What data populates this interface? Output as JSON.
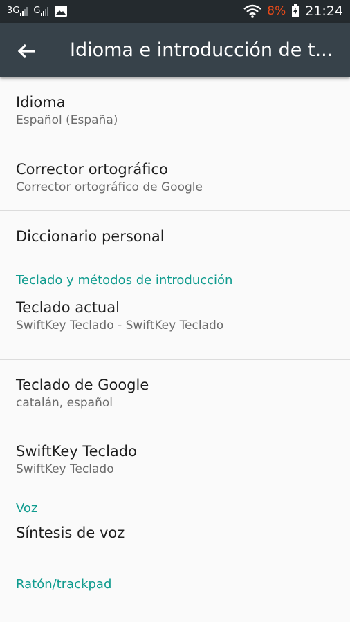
{
  "status_bar": {
    "network1": "3G",
    "network2": "G",
    "battery_percent": "8%",
    "time": "21:24",
    "icons": [
      "signal-icon",
      "image-icon",
      "wifi-icon",
      "battery-charging-icon"
    ],
    "colors": {
      "battery_low": "#e64a19"
    }
  },
  "app_bar": {
    "title": "Idioma e introducción de t...",
    "back_icon": "arrow-back-icon"
  },
  "items": [
    {
      "title": "Idioma",
      "subtitle": "Español (España)"
    },
    {
      "title": "Corrector ortográfico",
      "subtitle": "Corrector ortográfico de Google"
    },
    {
      "title": "Diccionario personal"
    },
    {
      "title": "Teclado actual",
      "subtitle": "SwiftKey Teclado - SwiftKey Teclado"
    },
    {
      "title": "Teclado de Google",
      "subtitle": "catalán, español"
    },
    {
      "title": "SwiftKey Teclado",
      "subtitle": "SwiftKey Teclado"
    },
    {
      "title": "Síntesis de voz"
    }
  ],
  "sections": {
    "keyboard": "Teclado y métodos de introducción",
    "voice": "Voz",
    "mouse": "Ratón/trackpad"
  },
  "colors": {
    "accent": "#0f9b8e",
    "appbar": "#37424a",
    "statusbar": "#242a2e"
  }
}
